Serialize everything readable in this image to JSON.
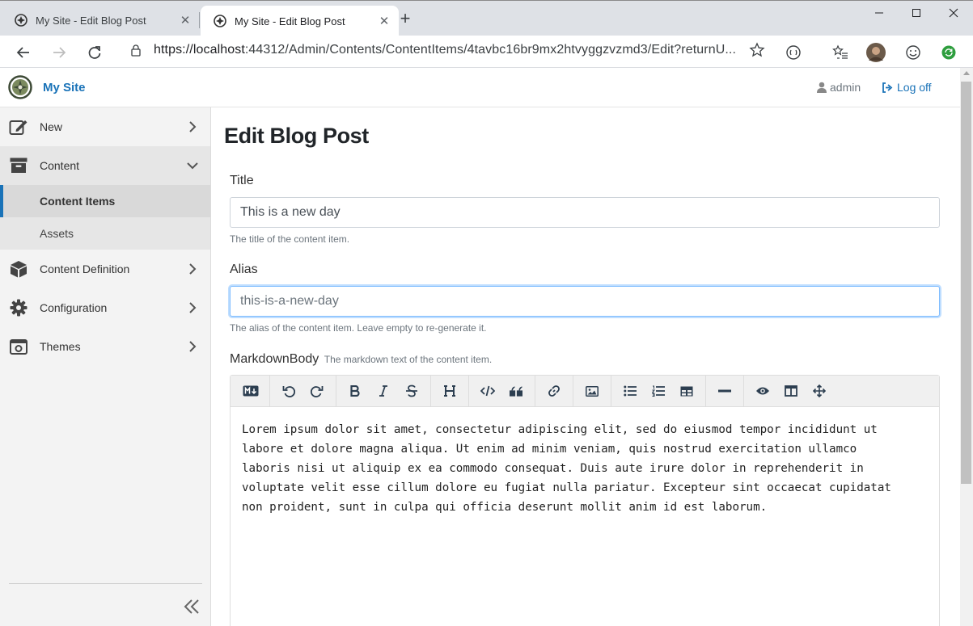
{
  "browser": {
    "tabs": [
      {
        "title": "My Site - Edit Blog Post",
        "active": false
      },
      {
        "title": "My Site - Edit Blog Post",
        "active": true
      }
    ],
    "url_scheme_host": "https://localhost",
    "url_rest": ":44312/Admin/Contents/ContentItems/4tavbc16br9mx2htvyggzvzmd3/Edit?returnU..."
  },
  "header": {
    "site_name": "My Site",
    "user": "admin",
    "logoff": "Log off"
  },
  "sidebar": {
    "items": [
      {
        "label": "New",
        "icon": "edit-icon"
      },
      {
        "label": "Content",
        "icon": "archive-icon"
      },
      {
        "label": "Content Definition",
        "icon": "cube-icon"
      },
      {
        "label": "Configuration",
        "icon": "gear-icon"
      },
      {
        "label": "Themes",
        "icon": "theme-icon"
      }
    ],
    "content_sub": [
      "Content Items",
      "Assets"
    ]
  },
  "page": {
    "title": "Edit Blog Post",
    "title_label": "Title",
    "title_value": "This is a new day",
    "title_hint": "The title of the content item.",
    "alias_label": "Alias",
    "alias_value": "this-is-a-new-day",
    "alias_hint": "The alias of the content item. Leave empty to re-generate it.",
    "markdown_label": "MarkdownBody",
    "markdown_hint": "The markdown text of the content item.",
    "markdown_text": "Lorem ipsum dolor sit amet, consectetur adipiscing elit, sed do eiusmod tempor incididunt ut\nlabore et dolore magna aliqua. Ut enim ad minim veniam, quis nostrud exercitation ullamco\nlaboris nisi ut aliquip ex ea commodo consequat. Duis aute irure dolor in reprehenderit in\nvoluptate velit esse cillum dolore eu fugiat nulla pariatur. Excepteur sint occaecat cupidatat\nnon proident, sunt in culpa qui officia deserunt mollit anim id est laborum."
  },
  "colors": {
    "accent": "#1a73b8",
    "sidebar_bg": "#f3f3f3"
  }
}
